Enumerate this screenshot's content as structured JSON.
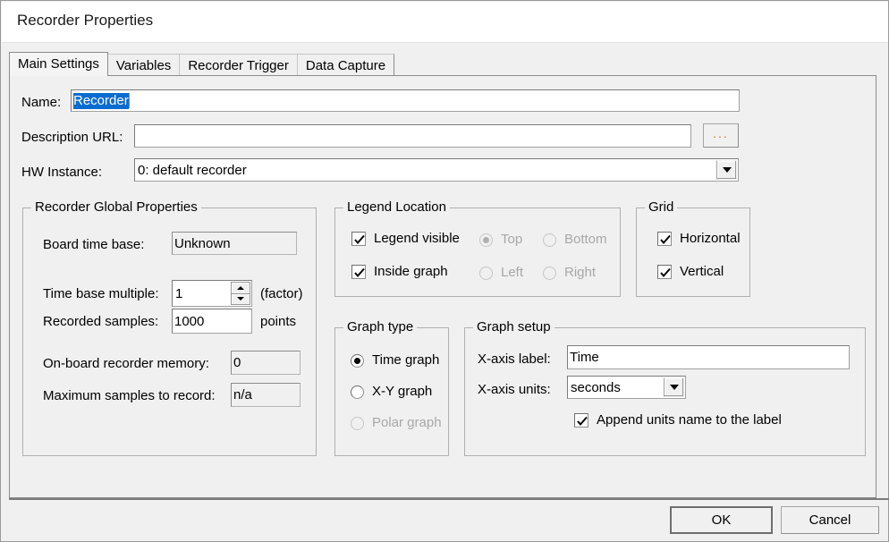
{
  "window": {
    "title": "Recorder Properties"
  },
  "tabs": [
    {
      "label": "Main Settings",
      "active": true
    },
    {
      "label": "Variables",
      "active": false
    },
    {
      "label": "Recorder Trigger",
      "active": false
    },
    {
      "label": "Data Capture",
      "active": false
    }
  ],
  "main_settings": {
    "name": {
      "label": "Name:",
      "value": "Recorder",
      "selected": true
    },
    "description_url": {
      "label": "Description URL:",
      "value": "",
      "browse_label": "..."
    },
    "hw_instance": {
      "label": "HW Instance:",
      "value": "0: default recorder"
    },
    "global_properties": {
      "title": "Recorder Global Properties",
      "board_time_base": {
        "label": "Board time base:",
        "value": "Unknown",
        "readonly": true
      },
      "time_base_multiple": {
        "label": "Time base multiple:",
        "value": "1",
        "unit": "(factor)"
      },
      "recorded_samples": {
        "label": "Recorded samples:",
        "value": "1000",
        "unit": "points"
      },
      "onboard_memory": {
        "label": "On-board recorder memory:",
        "value": "0",
        "readonly": true
      },
      "max_samples": {
        "label": "Maximum samples to record:",
        "value": "n/a",
        "readonly": true
      }
    },
    "legend_location": {
      "title": "Legend Location",
      "legend_visible": {
        "label": "Legend visible",
        "checked": true
      },
      "inside_graph": {
        "label": "Inside graph",
        "checked": true
      },
      "positions": [
        {
          "label": "Top",
          "selected": true,
          "disabled": true
        },
        {
          "label": "Bottom",
          "selected": false,
          "disabled": true
        },
        {
          "label": "Left",
          "selected": false,
          "disabled": true
        },
        {
          "label": "Right",
          "selected": false,
          "disabled": true
        }
      ]
    },
    "grid": {
      "title": "Grid",
      "horizontal": {
        "label": "Horizontal",
        "checked": true
      },
      "vertical": {
        "label": "Vertical",
        "checked": true
      }
    },
    "graph_type": {
      "title": "Graph type",
      "options": [
        {
          "label": "Time graph",
          "selected": true,
          "disabled": false
        },
        {
          "label": "X-Y graph",
          "selected": false,
          "disabled": false
        },
        {
          "label": "Polar graph",
          "selected": false,
          "disabled": true
        }
      ]
    },
    "graph_setup": {
      "title": "Graph setup",
      "x_axis_label": {
        "label": "X-axis label:",
        "value": "Time"
      },
      "x_axis_units": {
        "label": "X-axis units:",
        "value": "seconds"
      },
      "append_units": {
        "label": "Append units name to the label",
        "checked": true
      }
    }
  },
  "footer": {
    "ok_label": "OK",
    "cancel_label": "Cancel"
  }
}
